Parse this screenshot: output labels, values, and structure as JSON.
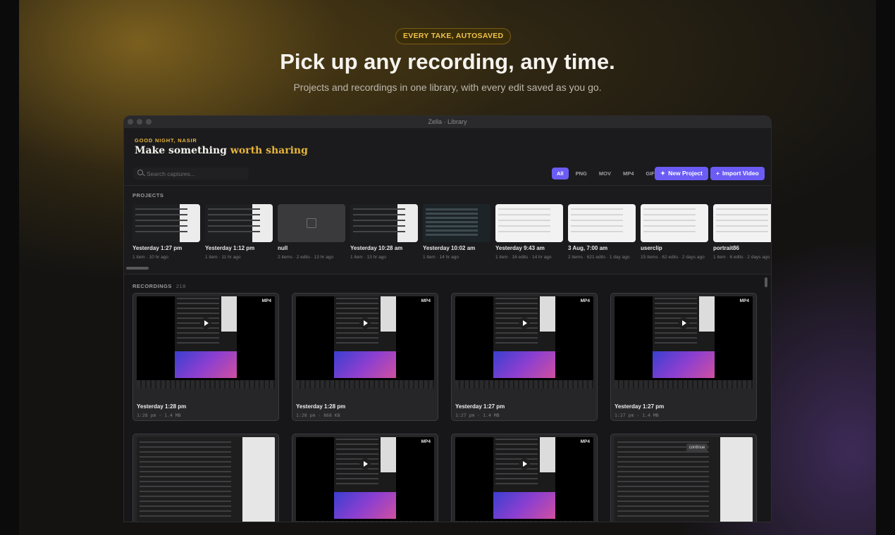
{
  "hero": {
    "badge": "EVERY TAKE, AUTOSAVED",
    "headline": "Pick up any recording, any time.",
    "subtitle": "Projects and recordings in one library, with every edit saved as you go."
  },
  "window": {
    "title": "Zella · Library",
    "greeting": "GOOD NIGHT, NASIR",
    "heading_plain": "Make something",
    "heading_accent": "worth sharing",
    "search_placeholder": "Search captures...",
    "filters": [
      "All",
      "PNG",
      "MOV",
      "MP4",
      "GIF"
    ],
    "active_filter": "All",
    "new_project_label": "New Project",
    "import_video_label": "Import Video",
    "accent_color": "#6b5cf6",
    "brand_color": "#e8b53a"
  },
  "projects": {
    "label": "PROJECTS",
    "items": [
      {
        "name": "Yesterday 1:27 pm",
        "meta": "1 item · 10 hr ago",
        "thumb": "screen"
      },
      {
        "name": "Yesterday 1:12 pm",
        "meta": "1 item · 11 hr ago",
        "thumb": "screen"
      },
      {
        "name": "null",
        "meta": "2 items · 2 edits · 13 hr ago",
        "thumb": "empty"
      },
      {
        "name": "Yesterday 10:28 am",
        "meta": "1 item · 13 hr ago",
        "thumb": "screen"
      },
      {
        "name": "Yesterday 10:02 am",
        "meta": "1 item · 14 hr ago",
        "thumb": "darkgrid"
      },
      {
        "name": "Yesterday 9:43 am",
        "meta": "1 item · 16 edits · 14 hr ago",
        "thumb": "light"
      },
      {
        "name": "3 Aug, 7:00 am",
        "meta": "2 items · 621 edits · 1 day ago",
        "thumb": "light"
      },
      {
        "name": "userclip",
        "meta": "15 items · 62 edits · 2 days ago",
        "thumb": "light"
      },
      {
        "name": "portrait86",
        "meta": "1 item · 6 edits · 2 days ago",
        "thumb": "light"
      }
    ]
  },
  "recordings": {
    "label": "RECORDINGS",
    "count": "218",
    "items": [
      {
        "name": "Yesterday 1:28 pm",
        "meta": "1:28 pm · 1.4 MB",
        "format": "MP4",
        "kind": "video"
      },
      {
        "name": "Yesterday 1:28 pm",
        "meta": "1:28 pm · 868 KB",
        "format": "MP4",
        "kind": "video"
      },
      {
        "name": "Yesterday 1:27 pm",
        "meta": "1:27 pm · 1.4 MB",
        "format": "MP4",
        "kind": "video"
      },
      {
        "name": "Yesterday 1:27 pm",
        "meta": "1:27 pm · 1.4 MB",
        "format": "MP4",
        "kind": "video"
      },
      {
        "name": "",
        "meta": "",
        "format": "",
        "kind": "doc",
        "pill": ""
      },
      {
        "name": "",
        "meta": "",
        "format": "MP4",
        "kind": "video"
      },
      {
        "name": "",
        "meta": "",
        "format": "MP4",
        "kind": "video"
      },
      {
        "name": "",
        "meta": "",
        "format": "",
        "kind": "doc",
        "pill": "continue"
      }
    ]
  }
}
